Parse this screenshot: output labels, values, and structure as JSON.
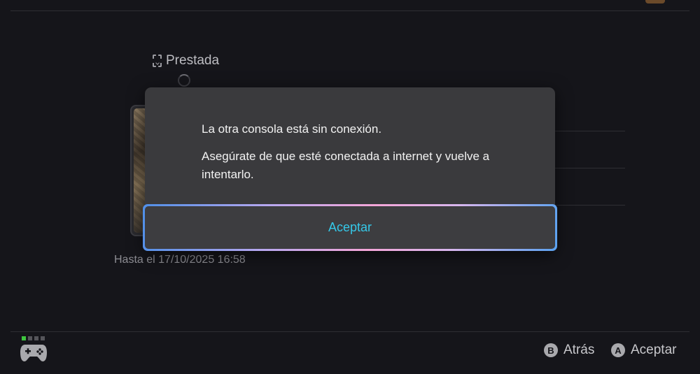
{
  "background": {
    "color": "#15151a"
  },
  "loan": {
    "label": "Prestada",
    "icon": "loan-tag-icon"
  },
  "expiry": {
    "text": "Hasta el 17/10/2025 16:58"
  },
  "dialog": {
    "title": "La otra consola está sin conexión.",
    "body": "Asegúrate de que esté conectada a internet y vuelve a intentarlo.",
    "accept_label": "Aceptar",
    "accent_color": "#35c8e8"
  },
  "footer": {
    "back": {
      "button": "B",
      "label": "Atrás"
    },
    "accept": {
      "button": "A",
      "label": "Aceptar"
    },
    "controller_icon": "controller-icon",
    "player_indicator_active_color": "#3ec43e"
  }
}
